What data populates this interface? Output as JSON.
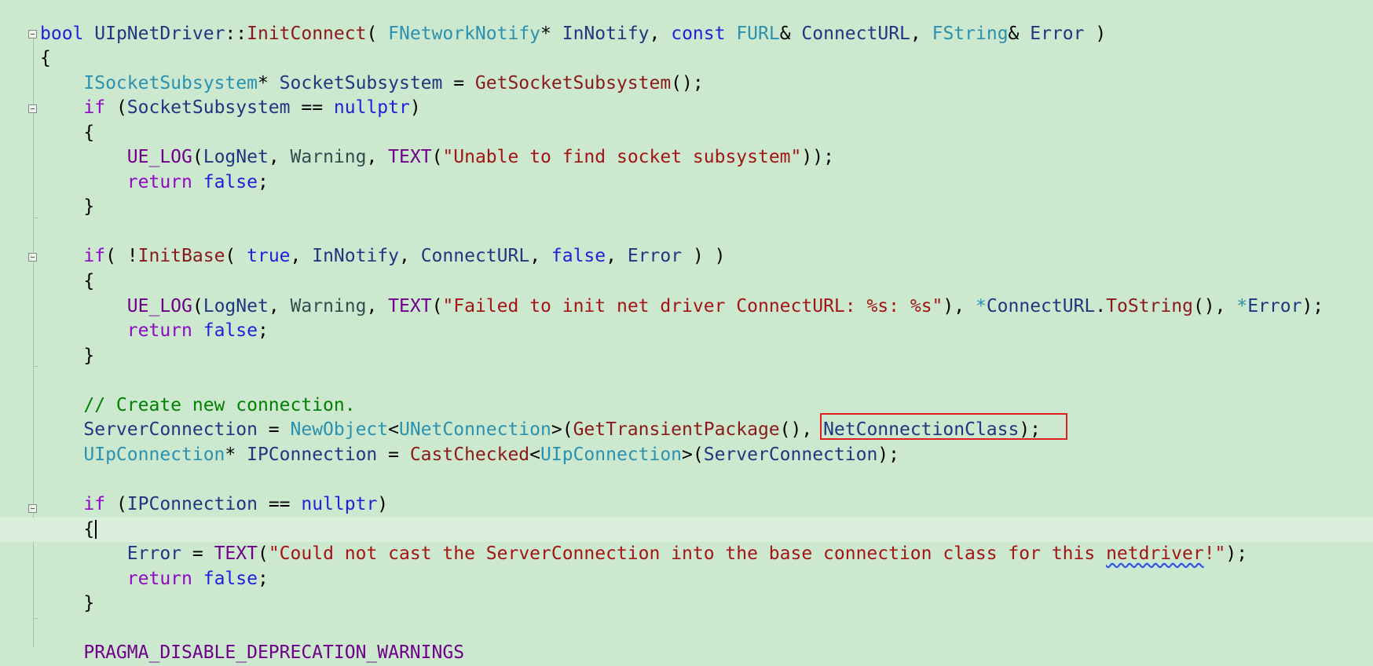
{
  "editor": {
    "lines": [
      [
        [
          "kw",
          "bool"
        ],
        [
          "txt",
          " "
        ],
        [
          "var",
          "UIpNetDriver"
        ],
        [
          "txt",
          "::"
        ],
        [
          "fn",
          "InitConnect"
        ],
        [
          "txt",
          "( "
        ],
        [
          "type",
          "FNetworkNotify"
        ],
        [
          "txt",
          "* "
        ],
        [
          "var",
          "InNotify"
        ],
        [
          "txt",
          ", "
        ],
        [
          "kw",
          "const"
        ],
        [
          "txt",
          " "
        ],
        [
          "type",
          "FURL"
        ],
        [
          "txt",
          "& "
        ],
        [
          "var",
          "ConnectURL"
        ],
        [
          "txt",
          ", "
        ],
        [
          "type",
          "FString"
        ],
        [
          "txt",
          "& "
        ],
        [
          "var",
          "Error"
        ],
        [
          "txt",
          " )"
        ]
      ],
      [
        [
          "txt",
          "{"
        ]
      ],
      [
        [
          "txt",
          "    "
        ],
        [
          "type",
          "ISocketSubsystem"
        ],
        [
          "txt",
          "* "
        ],
        [
          "var",
          "SocketSubsystem"
        ],
        [
          "txt",
          " = "
        ],
        [
          "fn",
          "GetSocketSubsystem"
        ],
        [
          "txt",
          "();"
        ]
      ],
      [
        [
          "txt",
          "    "
        ],
        [
          "ctl",
          "if"
        ],
        [
          "txt",
          " ("
        ],
        [
          "var",
          "SocketSubsystem"
        ],
        [
          "txt",
          " == "
        ],
        [
          "kw",
          "nullptr"
        ],
        [
          "txt",
          ")"
        ]
      ],
      [
        [
          "txt",
          "    {"
        ]
      ],
      [
        [
          "txt",
          "        "
        ],
        [
          "mac",
          "UE_LOG"
        ],
        [
          "txt",
          "("
        ],
        [
          "var",
          "LogNet"
        ],
        [
          "txt",
          ", "
        ],
        [
          "en",
          "Warning"
        ],
        [
          "txt",
          ", "
        ],
        [
          "mac",
          "TEXT"
        ],
        [
          "txt",
          "("
        ],
        [
          "str",
          "\"Unable to find socket subsystem\""
        ],
        [
          "txt",
          "));"
        ]
      ],
      [
        [
          "txt",
          "        "
        ],
        [
          "ctl",
          "return"
        ],
        [
          "txt",
          " "
        ],
        [
          "kw",
          "false"
        ],
        [
          "txt",
          ";"
        ]
      ],
      [
        [
          "txt",
          "    }"
        ]
      ],
      [],
      [
        [
          "txt",
          "    "
        ],
        [
          "ctl",
          "if"
        ],
        [
          "txt",
          "( !"
        ],
        [
          "fn",
          "InitBase"
        ],
        [
          "txt",
          "( "
        ],
        [
          "kw",
          "true"
        ],
        [
          "txt",
          ", "
        ],
        [
          "var",
          "InNotify"
        ],
        [
          "txt",
          ", "
        ],
        [
          "var",
          "ConnectURL"
        ],
        [
          "txt",
          ", "
        ],
        [
          "kw",
          "false"
        ],
        [
          "txt",
          ", "
        ],
        [
          "var",
          "Error"
        ],
        [
          "txt",
          " ) )"
        ]
      ],
      [
        [
          "txt",
          "    {"
        ]
      ],
      [
        [
          "txt",
          "        "
        ],
        [
          "mac",
          "UE_LOG"
        ],
        [
          "txt",
          "("
        ],
        [
          "var",
          "LogNet"
        ],
        [
          "txt",
          ", "
        ],
        [
          "en",
          "Warning"
        ],
        [
          "txt",
          ", "
        ],
        [
          "mac",
          "TEXT"
        ],
        [
          "txt",
          "("
        ],
        [
          "str",
          "\"Failed to init net driver ConnectURL: %s: %s\""
        ],
        [
          "txt",
          "), "
        ],
        [
          "type",
          "*"
        ],
        [
          "var",
          "ConnectURL"
        ],
        [
          "txt",
          "."
        ],
        [
          "fn",
          "ToString"
        ],
        [
          "txt",
          "(), "
        ],
        [
          "type",
          "*"
        ],
        [
          "var",
          "Error"
        ],
        [
          "txt",
          ");"
        ]
      ],
      [
        [
          "txt",
          "        "
        ],
        [
          "ctl",
          "return"
        ],
        [
          "txt",
          " "
        ],
        [
          "kw",
          "false"
        ],
        [
          "txt",
          ";"
        ]
      ],
      [
        [
          "txt",
          "    }"
        ]
      ],
      [],
      [
        [
          "txt",
          "    "
        ],
        [
          "cm",
          "// Create new connection."
        ]
      ],
      [
        [
          "txt",
          "    "
        ],
        [
          "var",
          "ServerConnection"
        ],
        [
          "txt",
          " = "
        ],
        [
          "type",
          "NewObject"
        ],
        [
          "txt",
          "<"
        ],
        [
          "type",
          "UNetConnection"
        ],
        [
          "txt",
          ">("
        ],
        [
          "fn",
          "GetTransientPackage"
        ],
        [
          "txt",
          "(), "
        ],
        [
          "var",
          "NetConnectionClass"
        ],
        [
          "txt",
          ");"
        ]
      ],
      [
        [
          "txt",
          "    "
        ],
        [
          "type",
          "UIpConnection"
        ],
        [
          "txt",
          "* "
        ],
        [
          "var",
          "IPConnection"
        ],
        [
          "txt",
          " = "
        ],
        [
          "fn",
          "CastChecked"
        ],
        [
          "txt",
          "<"
        ],
        [
          "type",
          "UIpConnection"
        ],
        [
          "txt",
          ">("
        ],
        [
          "var",
          "ServerConnection"
        ],
        [
          "txt",
          ");"
        ]
      ],
      [],
      [
        [
          "txt",
          "    "
        ],
        [
          "ctl",
          "if"
        ],
        [
          "txt",
          " ("
        ],
        [
          "var",
          "IPConnection"
        ],
        [
          "txt",
          " == "
        ],
        [
          "kw",
          "nullptr"
        ],
        [
          "txt",
          ")"
        ]
      ],
      [
        [
          "txt",
          "    {"
        ]
      ],
      [
        [
          "txt",
          "        "
        ],
        [
          "var",
          "Error"
        ],
        [
          "txt",
          " = "
        ],
        [
          "mac",
          "TEXT"
        ],
        [
          "txt",
          "("
        ],
        [
          "str",
          "\"Could not cast the ServerConnection into the base connection class for this "
        ],
        [
          "str squiggle",
          "netdriver"
        ],
        [
          "str",
          "!\""
        ],
        [
          "txt",
          ");"
        ]
      ],
      [
        [
          "txt",
          "        "
        ],
        [
          "ctl",
          "return"
        ],
        [
          "txt",
          " "
        ],
        [
          "kw",
          "false"
        ],
        [
          "txt",
          ";"
        ]
      ],
      [
        [
          "txt",
          "    }"
        ]
      ],
      [],
      [
        [
          "txt",
          "    "
        ],
        [
          "mac",
          "PRAGMA_DISABLE_DEPRECATION_WARNINGS"
        ]
      ]
    ]
  }
}
